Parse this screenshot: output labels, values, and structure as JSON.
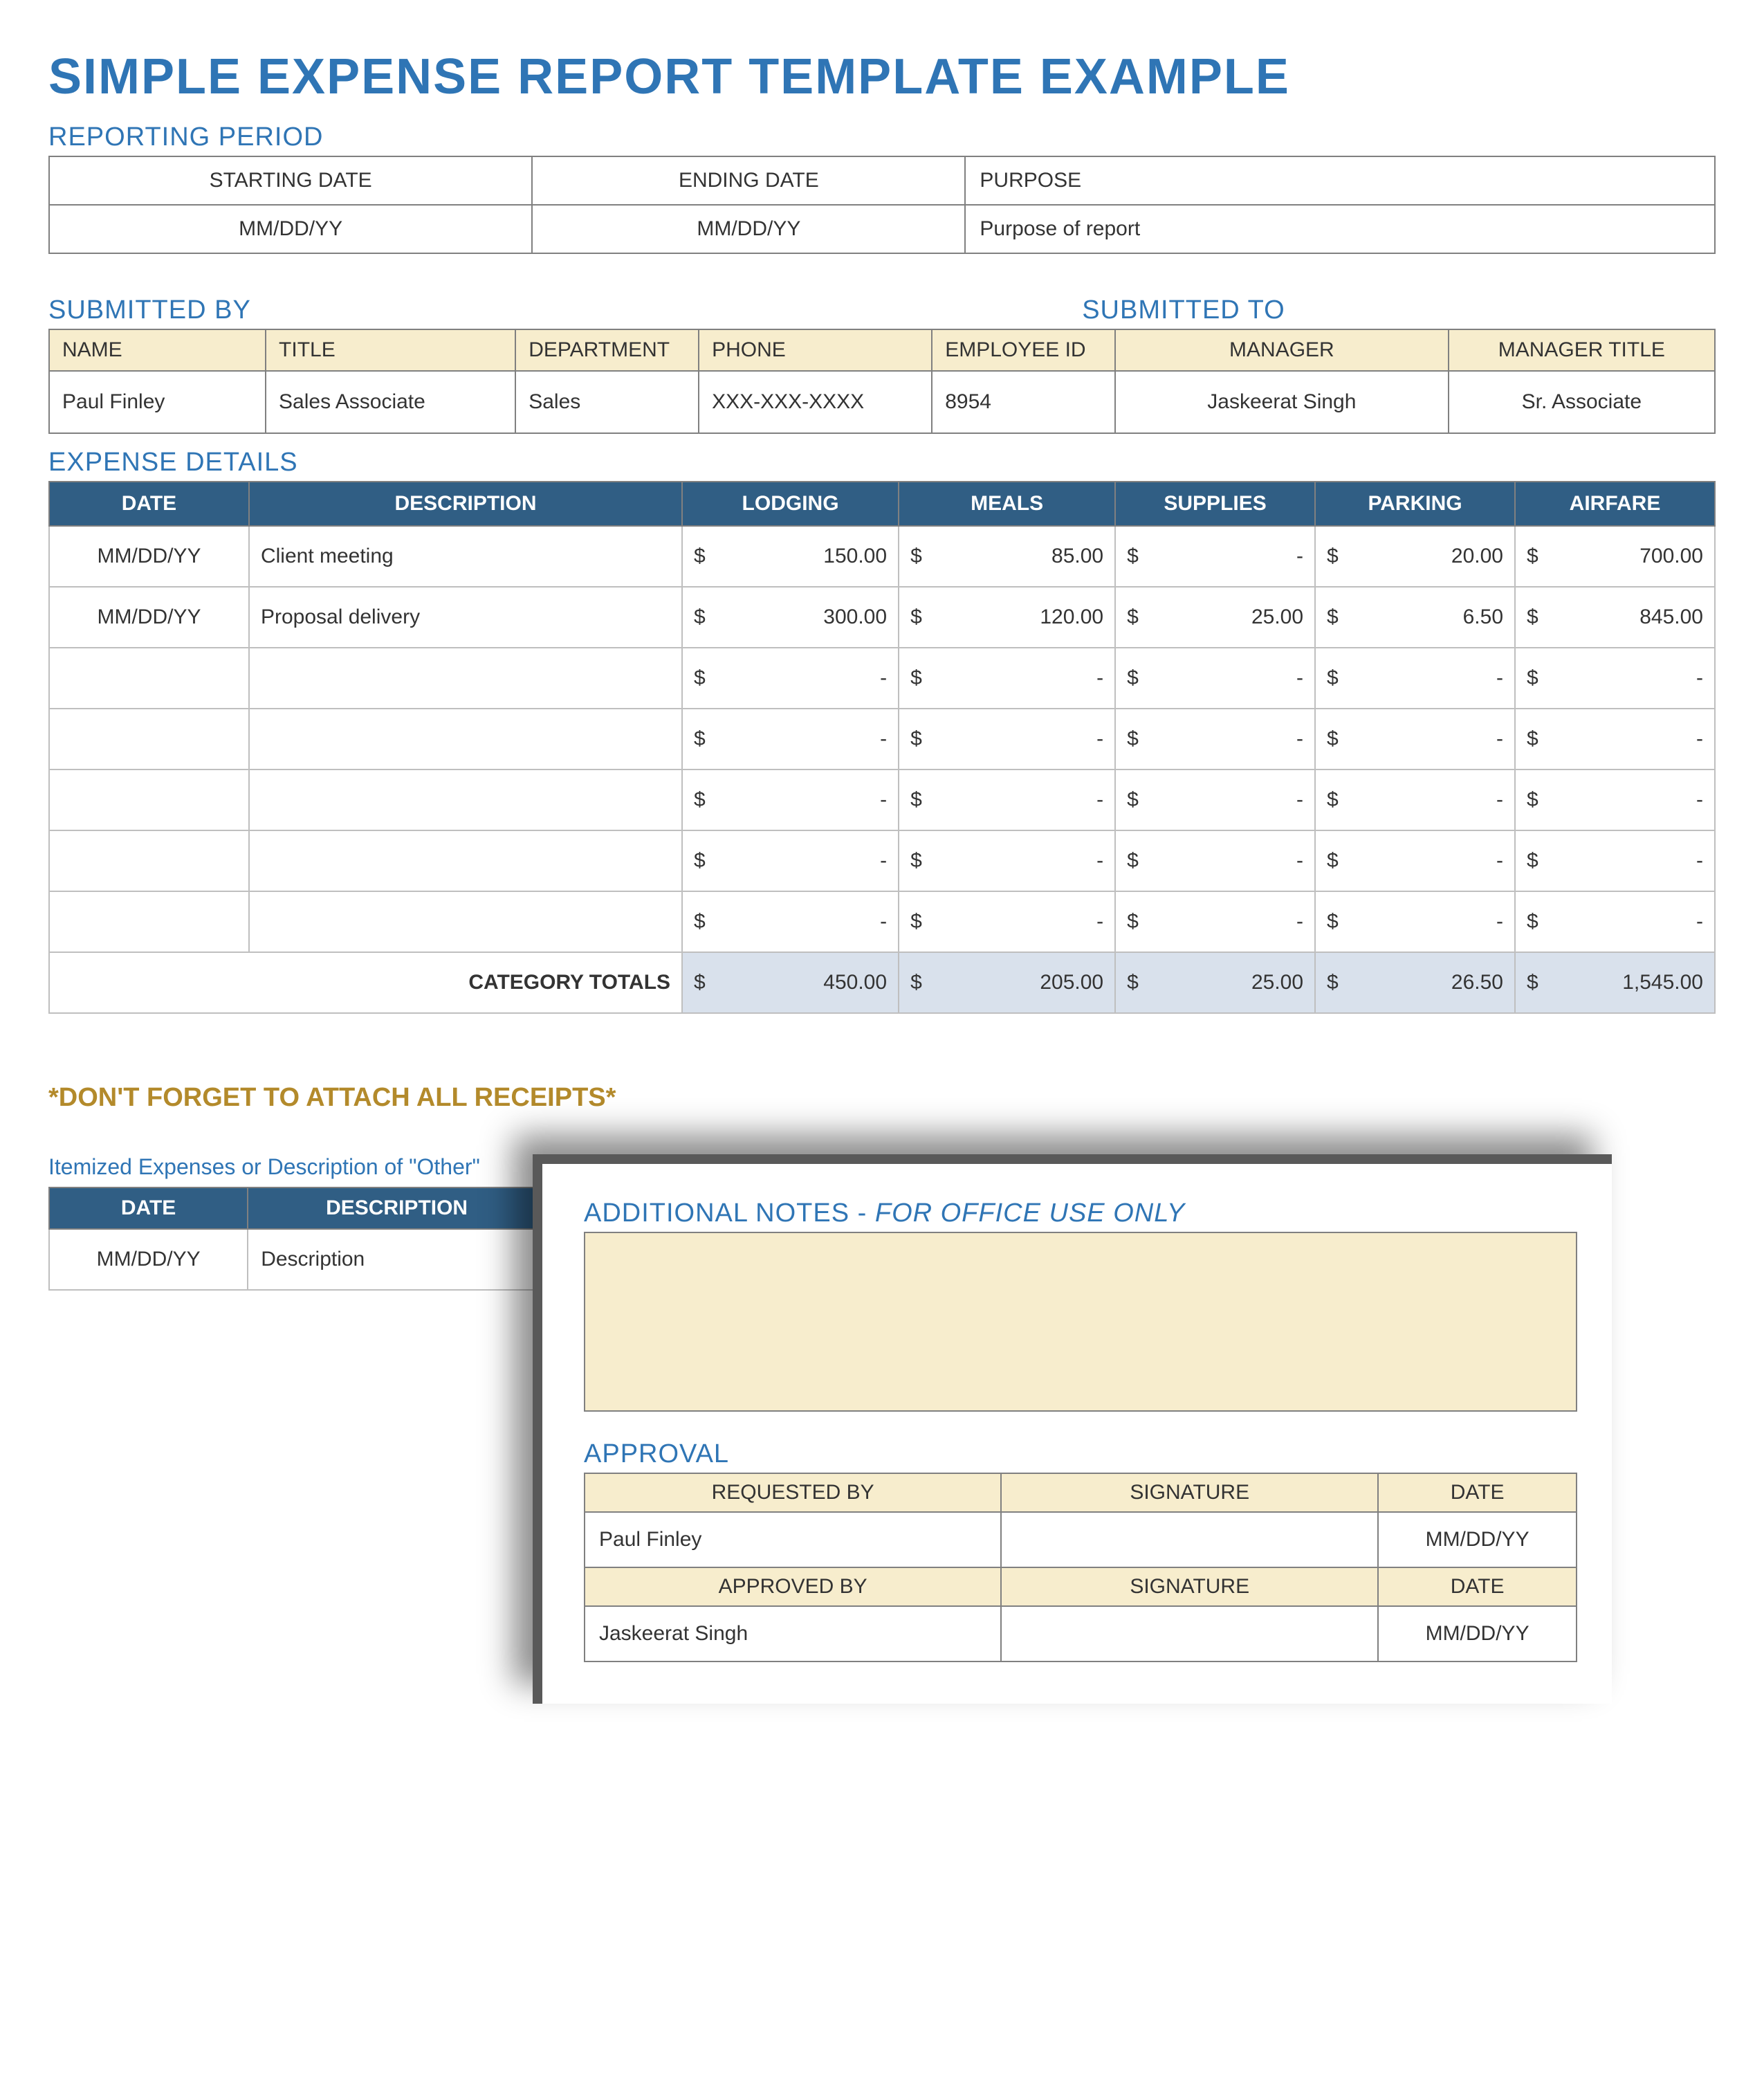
{
  "title": "SIMPLE EXPENSE REPORT TEMPLATE EXAMPLE",
  "reporting_period": {
    "heading": "REPORTING PERIOD",
    "headers": {
      "start": "STARTING DATE",
      "end": "ENDING DATE",
      "purpose": "PURPOSE"
    },
    "values": {
      "start": "MM/DD/YY",
      "end": "MM/DD/YY",
      "purpose": "Purpose of report"
    }
  },
  "submitted_by": {
    "heading": "SUBMITTED BY",
    "headers": {
      "name": "NAME",
      "title": "TITLE",
      "department": "DEPARTMENT",
      "phone": "PHONE",
      "employee_id": "EMPLOYEE ID"
    },
    "values": {
      "name": "Paul Finley",
      "title": "Sales Associate",
      "department": "Sales",
      "phone": "XXX-XXX-XXXX",
      "employee_id": "8954"
    }
  },
  "submitted_to": {
    "heading": "SUBMITTED TO",
    "headers": {
      "manager": "MANAGER",
      "manager_title": "MANAGER TITLE"
    },
    "values": {
      "manager": "Jaskeerat Singh",
      "manager_title": "Sr. Associate"
    }
  },
  "expense": {
    "heading": "EXPENSE DETAILS",
    "headers": {
      "date": "DATE",
      "description": "DESCRIPTION",
      "lodging": "LODGING",
      "meals": "MEALS",
      "supplies": "SUPPLIES",
      "parking": "PARKING",
      "airfare": "AIRFARE"
    },
    "currency": "$",
    "rows": [
      {
        "date": "MM/DD/YY",
        "description": "Client meeting",
        "lodging": "150.00",
        "meals": "85.00",
        "supplies": "-",
        "parking": "20.00",
        "airfare": "700.00"
      },
      {
        "date": "MM/DD/YY",
        "description": "Proposal delivery",
        "lodging": "300.00",
        "meals": "120.00",
        "supplies": "25.00",
        "parking": "6.50",
        "airfare": "845.00"
      },
      {
        "date": "",
        "description": "",
        "lodging": "-",
        "meals": "-",
        "supplies": "-",
        "parking": "-",
        "airfare": "-"
      },
      {
        "date": "",
        "description": "",
        "lodging": "-",
        "meals": "-",
        "supplies": "-",
        "parking": "-",
        "airfare": "-"
      },
      {
        "date": "",
        "description": "",
        "lodging": "-",
        "meals": "-",
        "supplies": "-",
        "parking": "-",
        "airfare": "-"
      },
      {
        "date": "",
        "description": "",
        "lodging": "-",
        "meals": "-",
        "supplies": "-",
        "parking": "-",
        "airfare": "-"
      },
      {
        "date": "",
        "description": "",
        "lodging": "-",
        "meals": "-",
        "supplies": "-",
        "parking": "-",
        "airfare": "-"
      }
    ],
    "totals_label": "CATEGORY TOTALS",
    "totals": {
      "lodging": "450.00",
      "meals": "205.00",
      "supplies": "25.00",
      "parking": "26.50",
      "airfare": "1,545.00"
    }
  },
  "receipts_note": "*DON'T FORGET TO ATTACH ALL RECEIPTS*",
  "itemized": {
    "heading": "Itemized Expenses or Description of \"Other\"",
    "headers": {
      "date": "DATE",
      "description": "DESCRIPTION"
    },
    "row": {
      "date": "MM/DD/YY",
      "description": "Description"
    }
  },
  "notes": {
    "heading_plain": "ADDITIONAL NOTES - ",
    "heading_italic": "FOR OFFICE USE ONLY"
  },
  "approval": {
    "heading": "APPROVAL",
    "headers": {
      "requested_by": "REQUESTED BY",
      "approved_by": "APPROVED BY",
      "signature": "SIGNATURE",
      "date": "DATE"
    },
    "requested": {
      "name": "Paul Finley",
      "signature": "",
      "date": "MM/DD/YY"
    },
    "approved": {
      "name": "Jaskeerat Singh",
      "signature": "",
      "date": "MM/DD/YY"
    }
  }
}
